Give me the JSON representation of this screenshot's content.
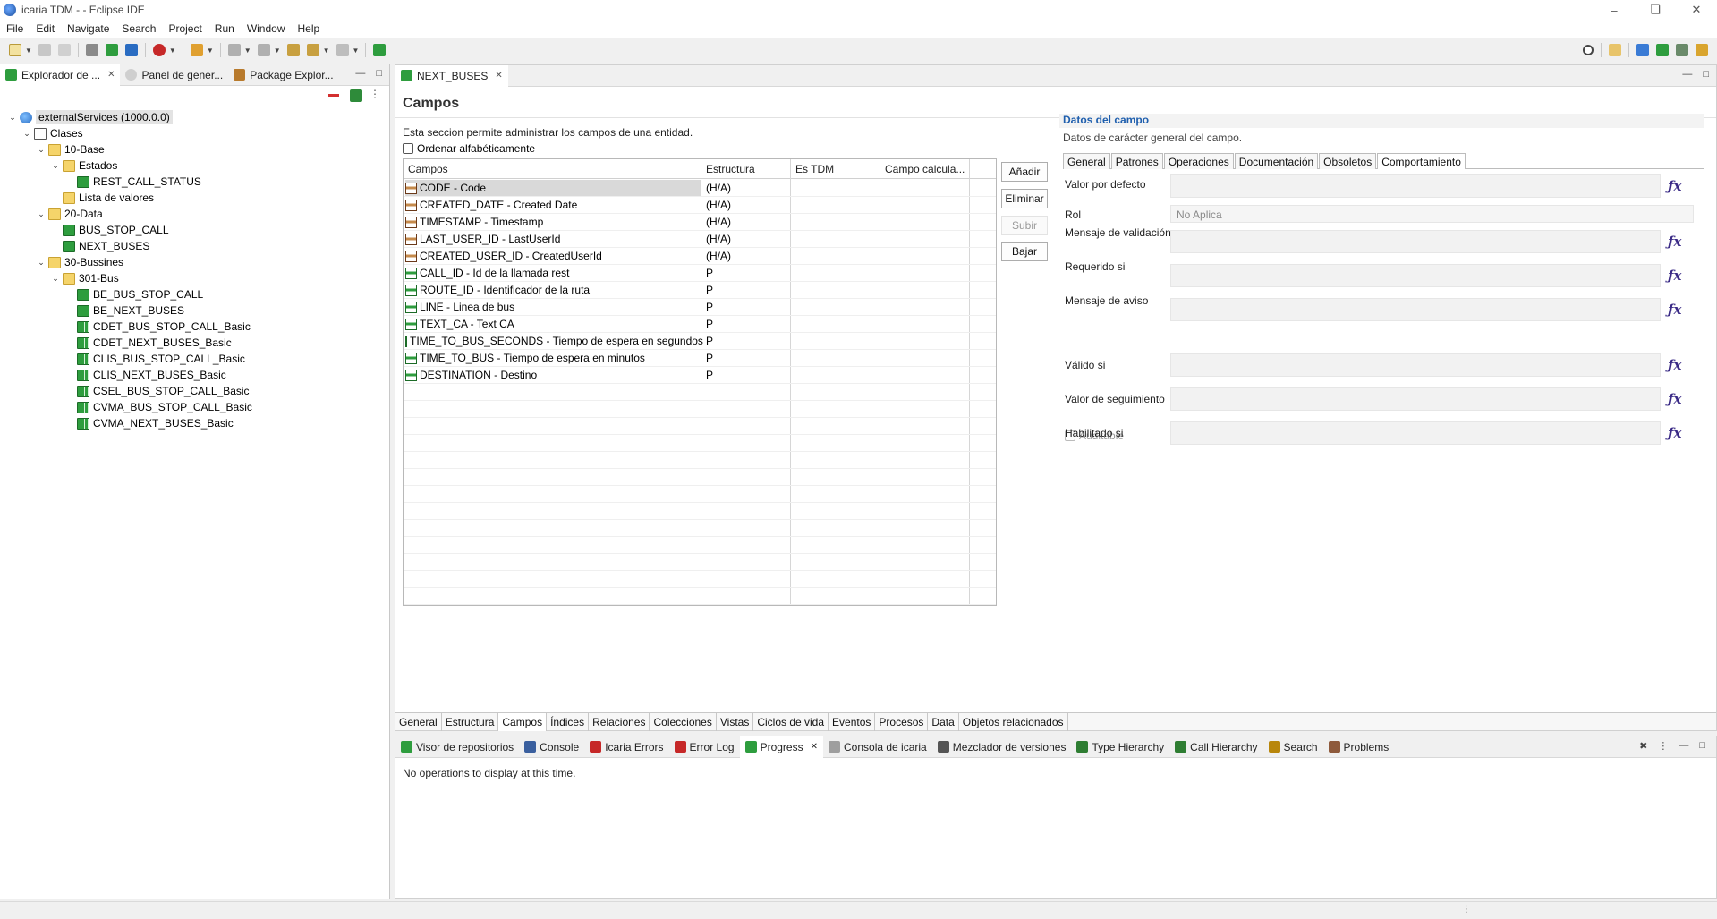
{
  "window": {
    "title": "icaria TDM -  - Eclipse IDE"
  },
  "menu": [
    "File",
    "Edit",
    "Navigate",
    "Search",
    "Project",
    "Run",
    "Window",
    "Help"
  ],
  "left_panel": {
    "tabs": [
      "Explorador de ...",
      "Panel de gener...",
      "Package Explor..."
    ],
    "tree": [
      {
        "label": "externalServices (1000.0.0)",
        "depth": 0,
        "icon": "globe-icon",
        "twisty": "v",
        "selected": true
      },
      {
        "label": "Clases",
        "depth": 1,
        "icon": "class-icon",
        "twisty": "v"
      },
      {
        "label": "10-Base",
        "depth": 2,
        "icon": "folder-icon",
        "twisty": "v"
      },
      {
        "label": "Estados",
        "depth": 3,
        "icon": "folder-icon",
        "twisty": "v"
      },
      {
        "label": "REST_CALL_STATUS",
        "depth": 4,
        "icon": "be-icon",
        "twisty": ""
      },
      {
        "label": "Lista de valores",
        "depth": 3,
        "icon": "folder-icon",
        "twisty": ""
      },
      {
        "label": "20-Data",
        "depth": 2,
        "icon": "folder-icon",
        "twisty": "v"
      },
      {
        "label": "BUS_STOP_CALL",
        "depth": 3,
        "icon": "entity-icon",
        "twisty": ""
      },
      {
        "label": "NEXT_BUSES",
        "depth": 3,
        "icon": "entity-icon",
        "twisty": ""
      },
      {
        "label": "30-Bussines",
        "depth": 2,
        "icon": "folder-icon",
        "twisty": "v"
      },
      {
        "label": "301-Bus",
        "depth": 3,
        "icon": "folder-icon",
        "twisty": "v"
      },
      {
        "label": "BE_BUS_STOP_CALL",
        "depth": 4,
        "icon": "be-icon",
        "twisty": ""
      },
      {
        "label": "BE_NEXT_BUSES",
        "depth": 4,
        "icon": "be-icon",
        "twisty": ""
      },
      {
        "label": "CDET_BUS_STOP_CALL_Basic",
        "depth": 4,
        "icon": "grid-icon",
        "twisty": ""
      },
      {
        "label": "CDET_NEXT_BUSES_Basic",
        "depth": 4,
        "icon": "grid-icon",
        "twisty": ""
      },
      {
        "label": "CLIS_BUS_STOP_CALL_Basic",
        "depth": 4,
        "icon": "grid-icon",
        "twisty": ""
      },
      {
        "label": "CLIS_NEXT_BUSES_Basic",
        "depth": 4,
        "icon": "grid-icon",
        "twisty": ""
      },
      {
        "label": "CSEL_BUS_STOP_CALL_Basic",
        "depth": 4,
        "icon": "grid-icon",
        "twisty": ""
      },
      {
        "label": "CVMA_BUS_STOP_CALL_Basic",
        "depth": 4,
        "icon": "grid-icon",
        "twisty": ""
      },
      {
        "label": "CVMA_NEXT_BUSES_Basic",
        "depth": 4,
        "icon": "grid-icon",
        "twisty": ""
      }
    ]
  },
  "editor": {
    "tab_label": "NEXT_BUSES",
    "section_title": "Campos",
    "description": "Esta seccion permite administrar los campos de una entidad.",
    "sort_checkbox_label": "Ordenar alfabéticamente",
    "table": {
      "headers": [
        "Campos",
        "Estructura",
        "Es TDM",
        "Campo calcula..."
      ],
      "rows": [
        {
          "name": "CODE - Code",
          "structure": "(H/A)",
          "kind": "h",
          "selected": true
        },
        {
          "name": "CREATED_DATE - Created Date",
          "structure": "(H/A)",
          "kind": "h"
        },
        {
          "name": "TIMESTAMP - Timestamp",
          "structure": "(H/A)",
          "kind": "h"
        },
        {
          "name": "LAST_USER_ID - LastUserId",
          "structure": "(H/A)",
          "kind": "h"
        },
        {
          "name": "CREATED_USER_ID - CreatedUserId",
          "structure": "(H/A)",
          "kind": "h"
        },
        {
          "name": "CALL_ID - Id de la llamada rest",
          "structure": "P",
          "kind": "p"
        },
        {
          "name": "ROUTE_ID - Identificador de la ruta",
          "structure": "P",
          "kind": "p"
        },
        {
          "name": "LINE - Linea de bus",
          "structure": "P",
          "kind": "p"
        },
        {
          "name": "TEXT_CA - Text CA",
          "structure": "P",
          "kind": "p"
        },
        {
          "name": "TIME_TO_BUS_SECONDS - Tiempo de espera en segundos",
          "structure": "P",
          "kind": "p"
        },
        {
          "name": "TIME_TO_BUS - Tiempo de espera en minutos",
          "structure": "P",
          "kind": "p"
        },
        {
          "name": "DESTINATION - Destino",
          "structure": "P",
          "kind": "p"
        }
      ]
    },
    "buttons": {
      "add": "Añadir",
      "delete": "Eliminar",
      "up": "Subir",
      "down": "Bajar"
    },
    "detail": {
      "title": "Datos del campo",
      "description": "Datos de carácter general del campo.",
      "tabs": [
        "General",
        "Patrones",
        "Operaciones",
        "Documentación",
        "Obsoletos",
        "Comportamiento"
      ],
      "active_tab": "Comportamiento",
      "fields": {
        "default_value": "Valor por defecto",
        "role": "Rol",
        "role_value": "No Aplica",
        "validation_message": "Mensaje de validación",
        "required_if": "Requerido si",
        "warning_message": "Mensaje de aviso",
        "auditable": "Auditable",
        "valid_if": "Válido si",
        "tracking_value": "Valor de seguimiento",
        "enabled_if": "Habilitado si"
      }
    },
    "bottom_tabs": [
      "General",
      "Estructura",
      "Campos",
      "Índices",
      "Relaciones",
      "Colecciones",
      "Vistas",
      "Ciclos de vida",
      "Eventos",
      "Procesos",
      "Data",
      "Objetos relacionados"
    ],
    "active_bottom_tab": "Campos"
  },
  "console": {
    "tabs": [
      {
        "label": "Visor de repositorios",
        "icon": "repository-icon",
        "color": "#2e9d3e"
      },
      {
        "label": "Console",
        "icon": "console-icon",
        "color": "#3a5f9e"
      },
      {
        "label": "Icaria Errors",
        "icon": "error-bug-icon",
        "color": "#c62828"
      },
      {
        "label": "Error Log",
        "icon": "error-log-icon",
        "color": "#c62828"
      },
      {
        "label": "Progress",
        "icon": "progress-icon",
        "color": "#2e9d3e",
        "active": true
      },
      {
        "label": "Consola de icaria",
        "icon": "icaria-console-icon",
        "color": "#9e9e9e"
      },
      {
        "label": "Mezclador de versiones",
        "icon": "merge-icon",
        "color": "#555555"
      },
      {
        "label": "Type Hierarchy",
        "icon": "hierarchy-icon",
        "color": "#2e7d32"
      },
      {
        "label": "Call Hierarchy",
        "icon": "call-hierarchy-icon",
        "color": "#2e7d32"
      },
      {
        "label": "Search",
        "icon": "search-icon",
        "color": "#b8860b"
      },
      {
        "label": "Problems",
        "icon": "problems-icon",
        "color": "#8e5a3c"
      }
    ],
    "message": "No operations to display at this time."
  }
}
